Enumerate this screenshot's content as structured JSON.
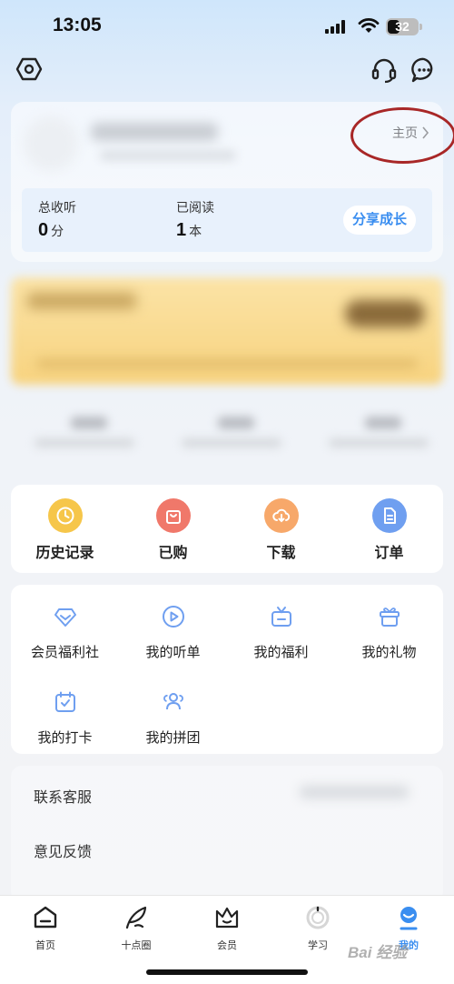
{
  "status_bar": {
    "time": "13:05",
    "battery": "32"
  },
  "profile": {
    "homepage_link": "主页"
  },
  "stats": {
    "total_listen_label": "总收听",
    "total_listen_value": "0",
    "total_listen_unit": "分",
    "read_label": "已阅读",
    "read_value": "1",
    "read_unit": "本",
    "share_button": "分享成长"
  },
  "quick_actions": [
    {
      "label": "历史记录",
      "icon": "clock-icon",
      "color": "#f6c64a"
    },
    {
      "label": "已购",
      "icon": "bag-icon",
      "color": "#f0786a"
    },
    {
      "label": "下载",
      "icon": "cloud-download-icon",
      "color": "#f7a86a"
    },
    {
      "label": "订单",
      "icon": "document-icon",
      "color": "#6f9ff0"
    }
  ],
  "services": [
    {
      "label": "会员福利社",
      "icon": "diamond-icon"
    },
    {
      "label": "我的听单",
      "icon": "play-icon"
    },
    {
      "label": "我的福利",
      "icon": "gift-box-icon"
    },
    {
      "label": "我的礼物",
      "icon": "present-icon"
    },
    {
      "label": "我的打卡",
      "icon": "calendar-check-icon"
    },
    {
      "label": "我的拼团",
      "icon": "group-icon"
    }
  ],
  "list": [
    {
      "label": "联系客服"
    },
    {
      "label": "意见反馈"
    }
  ],
  "tabs": [
    {
      "label": "首页",
      "icon": "home-icon"
    },
    {
      "label": "十点圈",
      "icon": "feather-icon"
    },
    {
      "label": "会员",
      "icon": "crown-icon"
    },
    {
      "label": "学习",
      "icon": "study-icon"
    },
    {
      "label": "我的",
      "icon": "profile-icon",
      "active": true
    }
  ],
  "colors": {
    "accent": "#3a8ef0",
    "circle_annotation": "#a82727",
    "service_icon": "#6f9ff0"
  },
  "watermark": "Bai 经验"
}
